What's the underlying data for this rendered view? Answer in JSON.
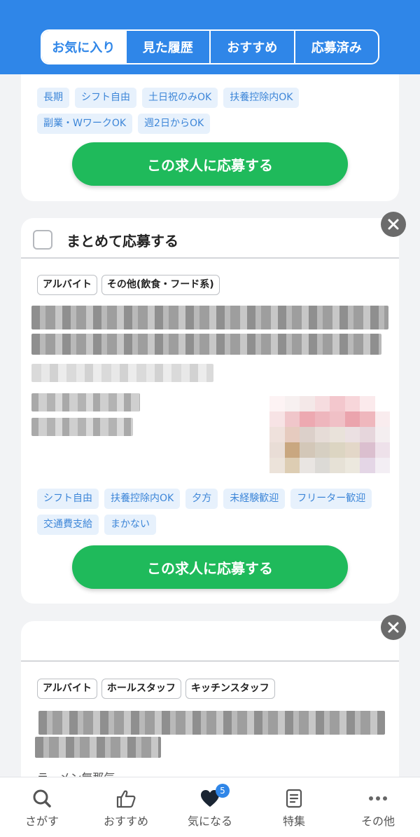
{
  "header": {
    "tabs": [
      {
        "label": "お気に入り",
        "active": true
      },
      {
        "label": "見た履歴",
        "active": false
      },
      {
        "label": "おすすめ",
        "active": false
      },
      {
        "label": "応募済み",
        "active": false
      }
    ]
  },
  "card1": {
    "tags": [
      "長期",
      "シフト自由",
      "土日祝のみOK",
      "扶養控除内OK",
      "副業・WワークOK",
      "週2日からOK"
    ],
    "apply_label": "この求人に応募する"
  },
  "card2": {
    "bulk_label": "まとめて応募する",
    "categories": [
      "アルバイト",
      "その他(飲食・フード系)"
    ],
    "tags": [
      "シフト自由",
      "扶養控除内OK",
      "夕方",
      "未経験歓迎",
      "フリーター歓迎",
      "交通費支給",
      "まかない"
    ],
    "apply_label": "この求人に応募する"
  },
  "card3": {
    "categories": [
      "アルバイト",
      "ホールスタッフ",
      "キッチンスタッフ"
    ],
    "partial_text": "ラーメン無那気"
  },
  "bottom_nav": {
    "items": [
      {
        "label": "さがす",
        "icon": "search-icon"
      },
      {
        "label": "おすすめ",
        "icon": "thumbs-up-icon"
      },
      {
        "label": "気になる",
        "icon": "heart-icon",
        "badge": "5"
      },
      {
        "label": "特集",
        "icon": "document-icon"
      },
      {
        "label": "その他",
        "icon": "more-icon"
      }
    ]
  },
  "colors": {
    "brand_blue": "#2f86e8",
    "apply_green": "#1fba5b",
    "tag_bg": "#e7f1fc",
    "tag_text": "#3d86d8"
  }
}
